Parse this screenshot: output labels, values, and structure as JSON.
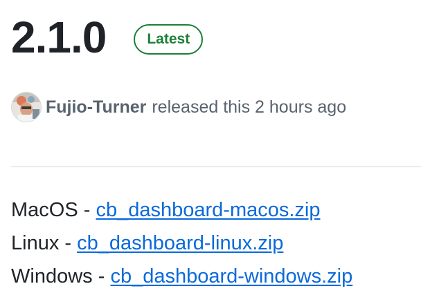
{
  "release": {
    "version": "2.1.0",
    "badge": "Latest"
  },
  "meta": {
    "author": "Fujio-Turner",
    "text": "released this 2 hours ago"
  },
  "downloads": [
    {
      "label": "MacOS",
      "separator": " - ",
      "link_text": "cb_dashboard-macos.zip"
    },
    {
      "label": "Linux",
      "separator": " - ",
      "link_text": "cb_dashboard-linux.zip"
    },
    {
      "label": "Windows",
      "separator": " - ",
      "link_text": "cb_dashboard-windows.zip"
    }
  ],
  "colors": {
    "badge_green": "#1a7f37",
    "link_blue": "#0969da",
    "muted_text": "#59636e"
  }
}
